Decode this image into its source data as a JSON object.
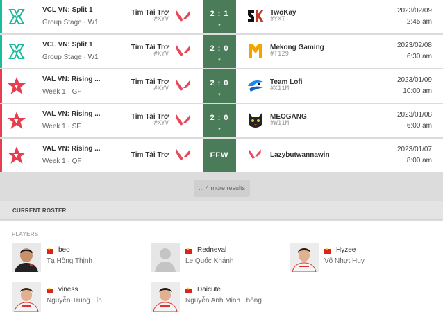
{
  "matches": [
    {
      "event": "VCL VN: Split 1",
      "stage": "Group Stage · W1",
      "event_icon": "vcl-logo-icon",
      "accent": "#1abc9c",
      "team_a": "Tim Tài Trơ",
      "team_a_tag": "#XYV",
      "score": "2 : 1",
      "team_b": "TwoKay",
      "team_b_tag": "#YXT",
      "team_b_icon": "twokay-logo-icon",
      "date": "2023/02/09",
      "time": "2:45 am"
    },
    {
      "event": "VCL VN: Split 1",
      "stage": "Group Stage · W1",
      "event_icon": "vcl-logo-icon",
      "accent": "#1abc9c",
      "team_a": "Tim Tài Trơ",
      "team_a_tag": "#XYV",
      "score": "2 : 0",
      "team_b": "Mekong Gaming",
      "team_b_tag": "#T129",
      "team_b_icon": "mekong-logo-icon",
      "date": "2023/02/08",
      "time": "6:30 am"
    },
    {
      "event": "VAL VN: Rising ...",
      "stage": "Week 1 · GF",
      "event_icon": "rising-star-logo-icon",
      "accent": "#e63e4e",
      "team_a": "Tim Tài Trơ",
      "team_a_tag": "#XYV",
      "score": "2 : 0",
      "team_b": "Team Lofi",
      "team_b_tag": "#X11M",
      "team_b_icon": "team-lofi-logo-icon",
      "date": "2023/01/09",
      "time": "10:00 am"
    },
    {
      "event": "VAL VN: Rising ...",
      "stage": "Week 1 · SF",
      "event_icon": "rising-star-logo-icon",
      "accent": "#e63e4e",
      "team_a": "Tim Tài Trơ",
      "team_a_tag": "#XYV",
      "score": "2 : 0",
      "team_b": "MEOGANG",
      "team_b_tag": "#W11M",
      "team_b_icon": "meogang-logo-icon",
      "date": "2023/01/08",
      "time": "6:00 am"
    },
    {
      "event": "VAL VN: Rising ...",
      "stage": "Week 1 · QF",
      "event_icon": "rising-star-logo-icon",
      "accent": "#e63e4e",
      "team_a": "Tim Tài Trơ",
      "team_a_tag": "",
      "score": "FFW",
      "team_b": "Lazybutwannawin",
      "team_b_tag": "",
      "team_b_icon": "valorant-logo-icon",
      "date": "2023/01/07",
      "time": "8:00 am"
    }
  ],
  "more_results": "... 4 more results",
  "roster": {
    "title": "CURRENT ROSTER",
    "players_label": "PLAYERS",
    "players": [
      {
        "nick": "beo",
        "real": "Tạ Hồng Thịnh",
        "flag": "vietnam-flag-icon"
      },
      {
        "nick": "Redneval",
        "real": "Le Quốc Khánh",
        "flag": "vietnam-flag-icon"
      },
      {
        "nick": "Hyzee",
        "real": "Võ Nhựt Huy",
        "flag": "vietnam-flag-icon"
      },
      {
        "nick": "viness",
        "real": "Nguyễn Trung Tín",
        "flag": "vietnam-flag-icon"
      },
      {
        "nick": "Daicute",
        "real": "Nguyễn Anh Minh Thông",
        "flag": "vietnam-flag-icon"
      }
    ]
  },
  "colors": {
    "score_bg": "#4a7c59",
    "valorant_red": "#e84857",
    "vcl_teal": "#1abc9c"
  }
}
